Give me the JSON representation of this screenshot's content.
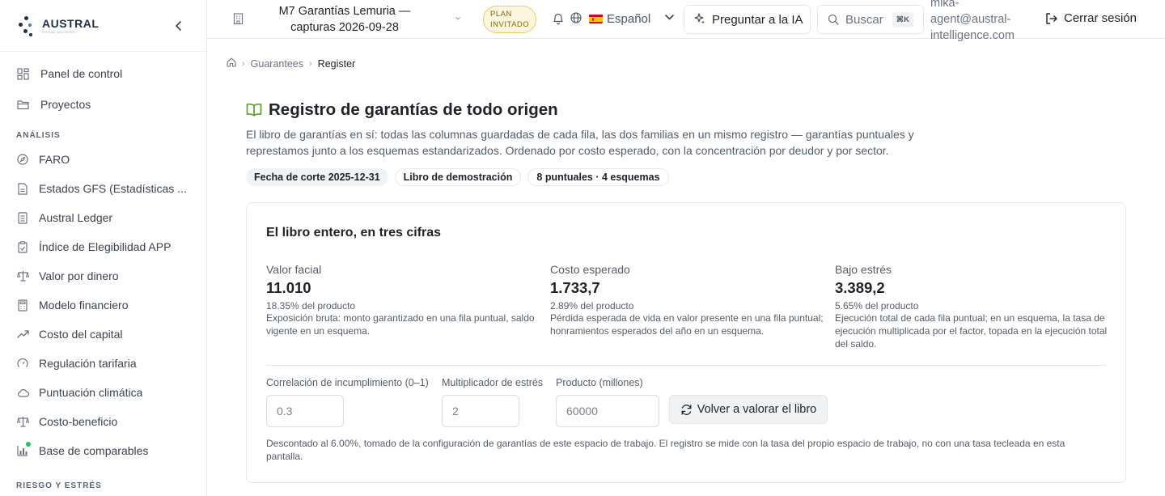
{
  "sidebar": {
    "brand": "AUSTRAL",
    "brand_sub": "FISCAL ADVISORY",
    "top_items": [
      {
        "label": "Panel de control",
        "icon": "dashboard-icon"
      },
      {
        "label": "Proyectos",
        "icon": "folder-icon"
      }
    ],
    "section_analysis": "ANÁLISIS",
    "analysis_items": [
      {
        "label": "FARO",
        "icon": "compass-icon"
      },
      {
        "label": "Estados GFS (Estadísticas ...",
        "icon": "file-icon"
      },
      {
        "label": "Austral Ledger",
        "icon": "ledger-icon"
      },
      {
        "label": "Índice de Elegibilidad APP",
        "icon": "clipboard-icon"
      },
      {
        "label": "Valor por dinero",
        "icon": "scale-icon"
      },
      {
        "label": "Modelo financiero",
        "icon": "calculator-icon"
      },
      {
        "label": "Costo del capital",
        "icon": "trend-icon"
      },
      {
        "label": "Regulación tarifaria",
        "icon": "gauge-icon"
      },
      {
        "label": "Puntuación climática",
        "icon": "cloud-icon"
      },
      {
        "label": "Costo-beneficio",
        "icon": "scale-icon"
      },
      {
        "label": "Base de comparables",
        "icon": "bar-chart-icon"
      }
    ],
    "section_risk": "RIESGO Y ESTRÉS"
  },
  "topbar": {
    "workspace_title": "M7 Garantías Lemuria — capturas 2026-09-28",
    "plan_line1": "PLAN",
    "plan_line2": "INVITADO",
    "language": "Español",
    "ask_ai": "Preguntar a la IA",
    "search_placeholder": "Buscar",
    "search_shortcut": "⌘K",
    "user_email": "mika-agent@austral-intelligence.com",
    "logout": "Cerrar sesión"
  },
  "breadcrumb": {
    "items": [
      "Guarantees",
      "Register"
    ]
  },
  "page": {
    "title": "Registro de garantías de todo origen",
    "description": "El libro de garantías en sí: todas las columnas guardadas de cada fila, las dos familias en un mismo registro — garantías puntuales y represtamos junto a los esquemas estandarizados. Ordenado por costo esperado, con la concentración por deudor y por sector.",
    "chips": [
      "Fecha de corte 2025-12-31",
      "Libro de demostración",
      "8 puntuales · 4 esquemas"
    ]
  },
  "card": {
    "title": "El libro entero, en tres cifras",
    "metrics": [
      {
        "label": "Valor facial",
        "value": "11.010",
        "pct": "18.35% del producto",
        "desc": "Exposición bruta: monto garantizado en una fila puntual, saldo vigente en un esquema."
      },
      {
        "label": "Costo esperado",
        "value": "1.733,7",
        "pct": "2.89% del producto",
        "desc": "Pérdida esperada de vida en valor presente en una fila puntual; honramientos esperados del año en un esquema."
      },
      {
        "label": "Bajo estrés",
        "value": "3.389,2",
        "pct": "5.65% del producto",
        "desc": "Ejecución total de cada fila puntual; en un esquema, la tasa de ejecución multiplicada por el factor, topada en la ejecución total del saldo."
      }
    ],
    "inputs": [
      {
        "label": "Correlación de incumplimiento (0–1)",
        "placeholder": "0.3"
      },
      {
        "label": "Multiplicador de estrés",
        "placeholder": "2"
      },
      {
        "label": "Producto (millones)",
        "placeholder": "60000"
      }
    ],
    "revalue_button": "Volver a valorar el libro",
    "footnote": "Descontado al 6.00%, tomado de la configuración de garantías de este espacio de trabajo. El registro se mide con la tasa del propio espacio de trabajo, no con una tasa tecleada en esta pantalla."
  }
}
